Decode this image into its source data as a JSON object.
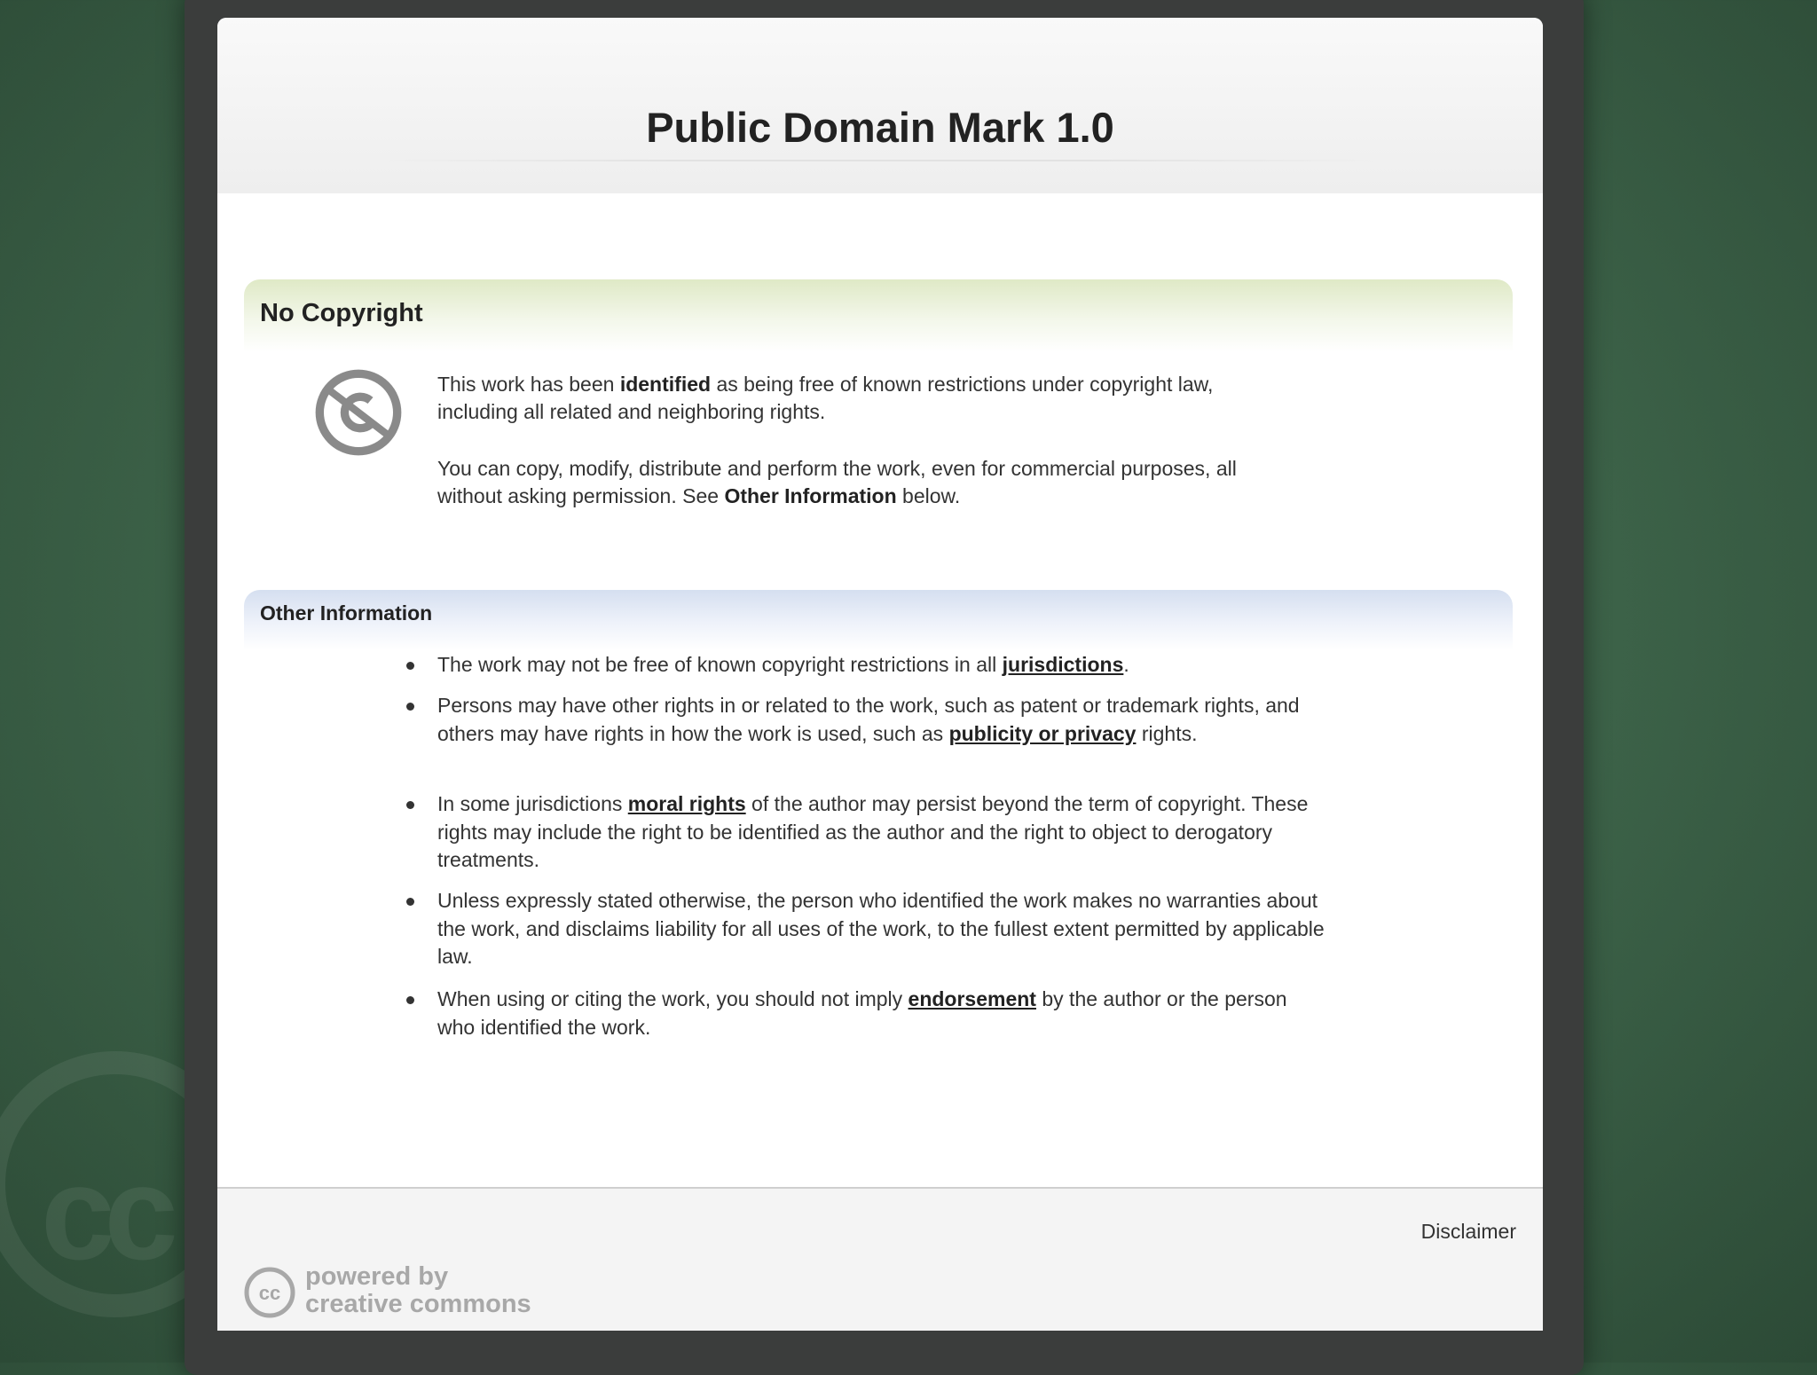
{
  "page": {
    "title": "Public Domain Mark 1.0"
  },
  "no_copyright": {
    "heading": "No Copyright",
    "icon": "no-copyright-icon",
    "p1_a": "This work has been ",
    "p1_bold": "identified",
    "p1_b": " as being free of known restrictions under copyright law, including all related and neighboring rights.",
    "p2_a": "You can copy, modify, distribute and perform the work, even for commercial purposes, all without asking permission. See ",
    "p2_bold": "Other Information",
    "p2_b": " below."
  },
  "other_info": {
    "heading": "Other Information",
    "items": [
      {
        "a": "The work may not be free of known copyright restrictions in all ",
        "link": "jurisdictions",
        "b": "."
      },
      {
        "a": "Persons may have other rights in or related to the work, such as patent or trademark rights, and others may have rights in how the work is used, such as ",
        "link": "publicity or privacy",
        "b": " rights."
      },
      {
        "a": "In some jurisdictions ",
        "link": "moral rights",
        "b": " of the author may persist beyond the term of copyright. These rights may include the right to be identified as the author and the right to object to derogatory treatments."
      },
      {
        "a": "Unless expressly stated otherwise, the person who identified the work makes no warranties about the work, and disclaims liability for all uses of the work, to the fullest extent permitted by applicable law.",
        "link": "",
        "b": ""
      },
      {
        "a": "When using or citing the work, you should not imply ",
        "link": "endorsement",
        "b": " by the author or the person who identified the work."
      }
    ]
  },
  "footer": {
    "disclaimer": "Disclaimer",
    "powered_line1": "powered by",
    "powered_line2": "creative commons",
    "logo_text": "cc"
  },
  "colors": {
    "background_green": "#3c6248",
    "frame": "#3b3d3c",
    "section_green": "#dfe9c6",
    "section_blue": "#d5dff0",
    "footer_text": "#a8a8a8"
  }
}
